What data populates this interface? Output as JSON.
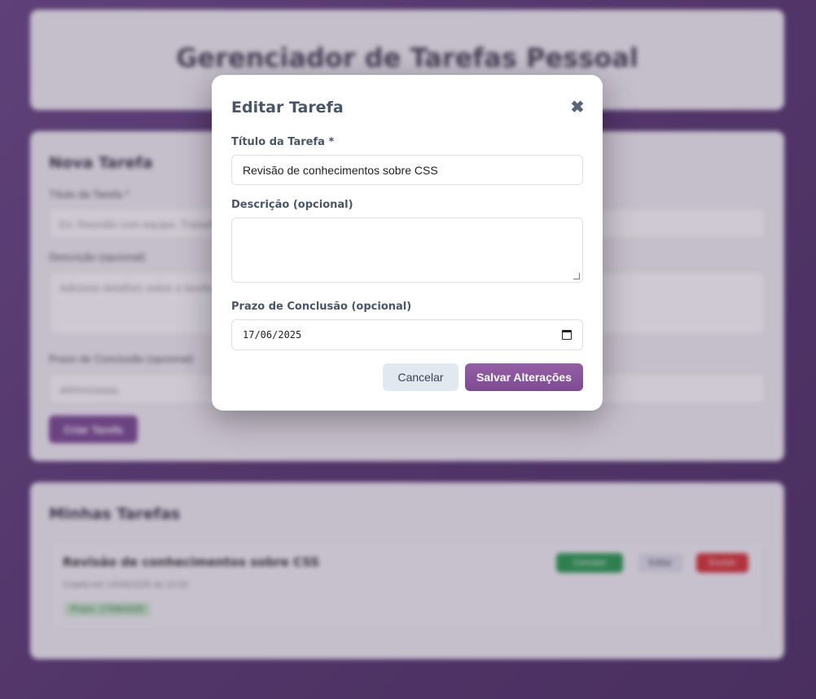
{
  "background": {
    "app_title": "Gerenciador de Tarefas Pessoal",
    "new_task": {
      "section_title": "Nova Tarefa",
      "title_label": "Título da Tarefa *",
      "title_placeholder": "Ex: Reunião com equipe, Trabalho...",
      "description_label": "Descrição (opcional)",
      "description_placeholder": "Adicione detalhes sobre a tarefa...",
      "deadline_label": "Prazo de Conclusão (opcional)",
      "deadline_value": "dd/mm/aaaa",
      "create_button": "Criar Tarefa"
    },
    "tasks": {
      "section_title": "Minhas Tarefas",
      "items": [
        {
          "title": "Revisão de conhecimentos sobre CSS",
          "meta": "Criada em 14/06/2025 às 10:32",
          "deadline": "Prazo: 17/06/2025",
          "complete_label": "Concluir",
          "edit_label": "Editar",
          "delete_label": "Excluir"
        }
      ]
    }
  },
  "modal": {
    "title": "Editar Tarefa",
    "close_symbol": "✖",
    "title_label": "Título da Tarefa *",
    "title_value": "Revisão de conhecimentos sobre CSS",
    "description_label": "Descrição (opcional)",
    "description_value": "",
    "deadline_label": "Prazo de Conclusão (opcional)",
    "deadline_value": "17/06/2025",
    "cancel_button": "Cancelar",
    "save_button": "Salvar Alterações"
  },
  "icons": {
    "close": "close-icon",
    "calendar": "calendar-icon"
  },
  "colors": {
    "accent": "#7d4a92",
    "page_bg": "#5a3a72"
  }
}
